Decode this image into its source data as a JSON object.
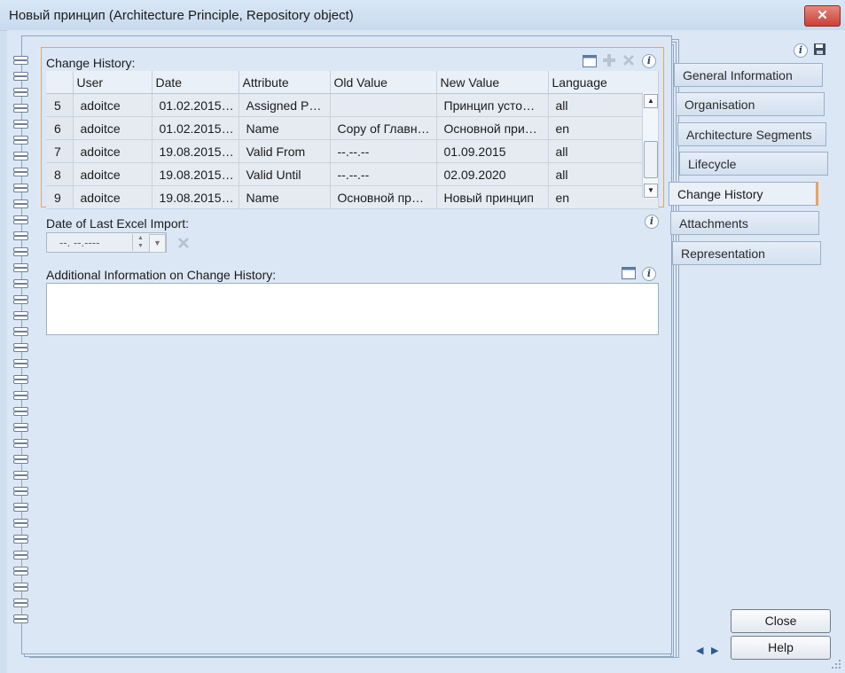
{
  "window": {
    "title": "Новый принцип (Architecture Principle, Repository object)",
    "close_glyph": "✕"
  },
  "change_history": {
    "label": "Change History:",
    "columns": [
      "",
      "User",
      "Date",
      "Attribute",
      "Old Value",
      "New Value",
      "Language"
    ],
    "rows": [
      {
        "num": "5",
        "user": "adoitce",
        "date": "01.02.2015…",
        "attribute": "Assigned P…",
        "old": "",
        "new": "Принцип усто…",
        "lang": "all"
      },
      {
        "num": "6",
        "user": "adoitce",
        "date": "01.02.2015…",
        "attribute": "Name",
        "old": "Copy of Главн…",
        "new": "Основной при…",
        "lang": "en"
      },
      {
        "num": "7",
        "user": "adoitce",
        "date": "19.08.2015…",
        "attribute": "Valid From",
        "old": "--.--.--",
        "new": "01.09.2015",
        "lang": "all"
      },
      {
        "num": "8",
        "user": "adoitce",
        "date": "19.08.2015…",
        "attribute": "Valid Until",
        "old": "--.--.--",
        "new": "02.09.2020",
        "lang": "all"
      },
      {
        "num": "9",
        "user": "adoitce",
        "date": "19.08.2015…",
        "attribute": "Name",
        "old": "Основной пр…",
        "new": "Новый принцип",
        "lang": "en"
      }
    ]
  },
  "excel_import": {
    "label": "Date of Last Excel Import:",
    "value": "--.  --.----"
  },
  "additional_info": {
    "label": "Additional Information on Change History:",
    "value": ""
  },
  "tabs": [
    {
      "label": "General Information"
    },
    {
      "label": "Organisation"
    },
    {
      "label": "Architecture Segments"
    },
    {
      "label": "Lifecycle"
    },
    {
      "label": "Change History"
    },
    {
      "label": "Attachments"
    },
    {
      "label": "Representation"
    }
  ],
  "buttons": {
    "close": "Close",
    "help": "Help"
  },
  "icons": {
    "info": "i",
    "save": "save-icon",
    "open_window": "window-icon",
    "add": "plus-icon",
    "delete": "x-icon"
  },
  "colors": {
    "accent_orange": "#eea25a",
    "background": "#dbe7f5"
  }
}
